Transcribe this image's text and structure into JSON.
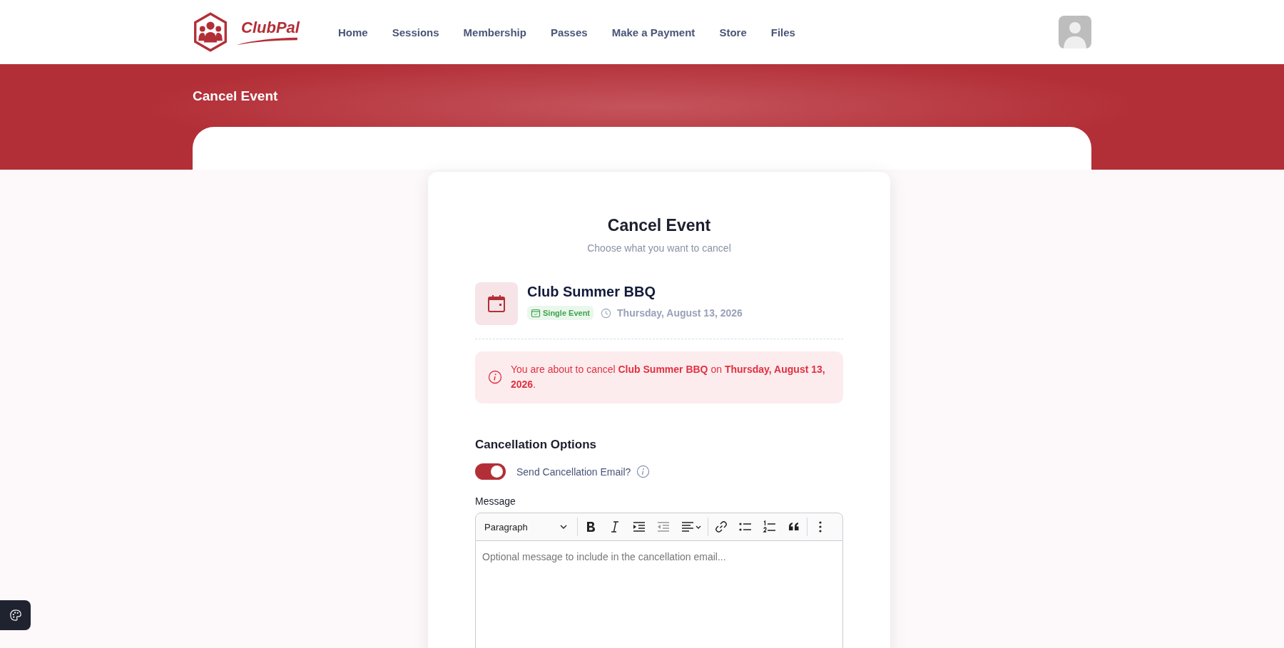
{
  "logo": {
    "text": "ClubPal"
  },
  "nav": [
    {
      "label": "Home"
    },
    {
      "label": "Sessions"
    },
    {
      "label": "Membership"
    },
    {
      "label": "Passes"
    },
    {
      "label": "Make a Payment"
    },
    {
      "label": "Store"
    },
    {
      "label": "Files"
    }
  ],
  "page_title": "Cancel Event",
  "card": {
    "title": "Cancel Event",
    "subtitle": "Choose what you want to cancel",
    "event": {
      "name": "Club Summer BBQ",
      "badge": "Single Event",
      "date": "Thursday, August 13, 2026"
    },
    "alert": "You are about to cancel **Club Summer BBQ** on **Thursday, August 13, 2026**.",
    "section_title": "Cancellation Options",
    "toggle": {
      "label": "Send Cancellation Email?",
      "on": true
    },
    "message": {
      "label": "Message",
      "block_format": "Paragraph",
      "placeholder": "Optional message to include in the cancellation email..."
    }
  }
}
